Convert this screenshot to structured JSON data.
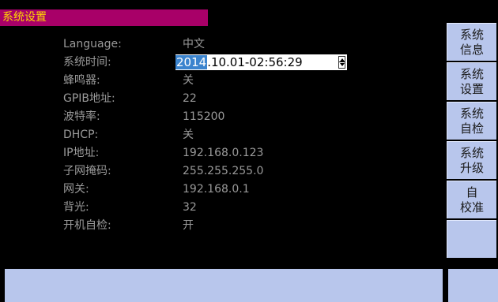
{
  "title": "系统设置",
  "settings": [
    {
      "label": "Language:",
      "value": "中文"
    },
    {
      "label": "系统时间:",
      "value": ""
    },
    {
      "label": "蜂鸣器:",
      "value": "关"
    },
    {
      "label": "GPIB地址:",
      "value": "22"
    },
    {
      "label": "波特率:",
      "value": "115200"
    },
    {
      "label": "DHCP:",
      "value": "关"
    },
    {
      "label": "IP地址:",
      "value": "192.168.0.123"
    },
    {
      "label": "子网掩码:",
      "value": "255.255.255.0"
    },
    {
      "label": "网关:",
      "value": "192.168.0.1"
    },
    {
      "label": "背光:",
      "value": "32"
    },
    {
      "label": "开机自检:",
      "value": "开"
    }
  ],
  "system_time": {
    "year": "2014",
    "rest": ".10.01-02:56:29"
  },
  "side_buttons": [
    {
      "line1": "系统",
      "line2": "信息"
    },
    {
      "line1": "系统",
      "line2": "设置"
    },
    {
      "line1": "系统",
      "line2": "自检"
    },
    {
      "line1": "系统",
      "line2": "升级"
    },
    {
      "line1": "自",
      "line2": "校准"
    },
    {
      "line1": "",
      "line2": ""
    }
  ],
  "colors": {
    "title_bg": "#a80068",
    "title_text": "#ffd800",
    "panel": "#b8c6ec",
    "highlight": "#3b84ce"
  }
}
